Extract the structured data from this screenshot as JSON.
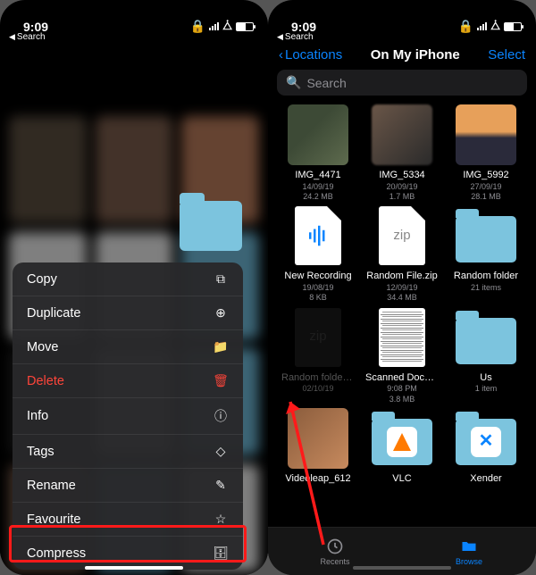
{
  "status": {
    "time": "9:09",
    "back_label": "Search"
  },
  "left": {
    "menu": [
      {
        "label": "Copy",
        "icon": "copy-icon",
        "glyph": "⧉",
        "destructive": false
      },
      {
        "label": "Duplicate",
        "icon": "duplicate-icon",
        "glyph": "⊕",
        "destructive": false
      },
      {
        "label": "Move",
        "icon": "move-icon",
        "glyph": "📁",
        "destructive": false
      },
      {
        "label": "Delete",
        "icon": "trash-icon",
        "glyph": "🗑",
        "destructive": true
      },
      {
        "label": "Info",
        "icon": "info-icon",
        "glyph": "ⓘ",
        "destructive": false
      },
      {
        "label": "Tags",
        "icon": "tags-icon",
        "glyph": "◇",
        "destructive": false
      },
      {
        "label": "Rename",
        "icon": "rename-icon",
        "glyph": "✎",
        "destructive": false
      },
      {
        "label": "Favourite",
        "icon": "favourite-icon",
        "glyph": "☆",
        "destructive": false
      },
      {
        "label": "Compress",
        "icon": "compress-icon",
        "glyph": "🗄",
        "destructive": false
      }
    ],
    "highlight_index": 8
  },
  "right": {
    "nav": {
      "back": "Locations",
      "title": "On My iPhone",
      "action": "Select"
    },
    "search_placeholder": "Search",
    "items": [
      {
        "name": "IMG_4471",
        "line1": "14/09/19",
        "line2": "24.2 MB",
        "thumb": "photo1"
      },
      {
        "name": "IMG_5334",
        "line1": "20/09/19",
        "line2": "1.7 MB",
        "thumb": "photo2"
      },
      {
        "name": "IMG_5992",
        "line1": "27/09/19",
        "line2": "28.1 MB",
        "thumb": "photo3"
      },
      {
        "name": "New Recording",
        "line1": "19/08/19",
        "line2": "8 KB",
        "thumb": "audio"
      },
      {
        "name": "Random File.zip",
        "line1": "12/09/19",
        "line2": "34.4 MB",
        "thumb": "zip"
      },
      {
        "name": "Random folder",
        "line1": "21 items",
        "line2": "",
        "thumb": "folder"
      },
      {
        "name": "Random folder.zip",
        "line1": "02/10/19",
        "line2": "",
        "thumb": "zipdim",
        "dim": true
      },
      {
        "name": "Scanned Document",
        "line1": "9:08 PM",
        "line2": "3.8 MB",
        "thumb": "docscan"
      },
      {
        "name": "Us",
        "line1": "1 item",
        "line2": "",
        "thumb": "folder"
      },
      {
        "name": "Videoleap_612",
        "line1": "",
        "line2": "",
        "thumb": "video"
      },
      {
        "name": "VLC",
        "line1": "",
        "line2": "",
        "thumb": "vlc"
      },
      {
        "name": "Xender",
        "line1": "",
        "line2": "",
        "thumb": "xender"
      }
    ],
    "tabs": {
      "recents": "Recents",
      "browse": "Browse"
    }
  }
}
